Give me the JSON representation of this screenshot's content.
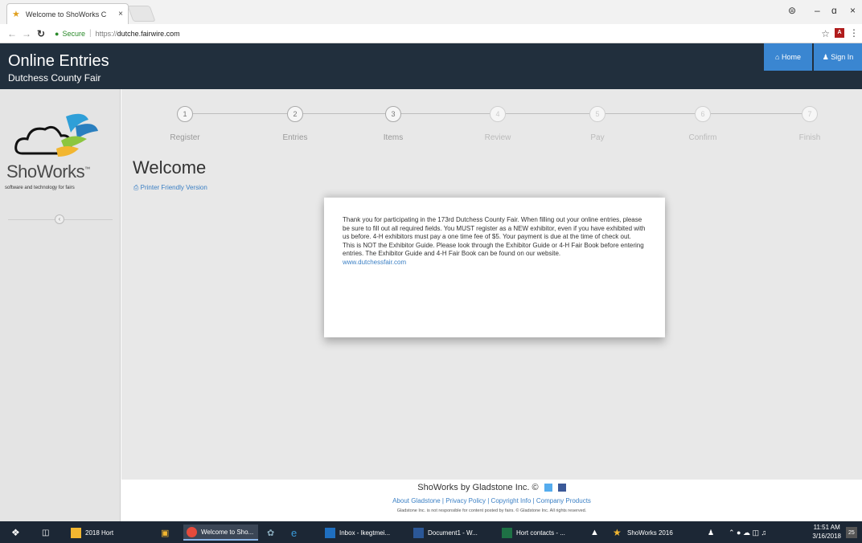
{
  "browser": {
    "tab_title": "Welcome to ShoWorks C",
    "tab_close": "×",
    "secure_label": "Secure",
    "url_scheme": "https://",
    "url_host": "dutche.fairwire.com",
    "window_controls": {
      "profile": "⊜",
      "minimize": "–",
      "maximize": "ɑ",
      "close": "×"
    }
  },
  "header": {
    "title": "Online Entries",
    "subtitle": "Dutchess County Fair",
    "home_label": "⌂ Home",
    "signin_label": "♟ Sign In"
  },
  "sidebar": {
    "logo_text": "ShoWorks",
    "logo_tm": "™",
    "tagline": "software and technology for fairs",
    "collapse_glyph": "‹"
  },
  "steps": [
    {
      "num": "1",
      "label": "Register",
      "active": true
    },
    {
      "num": "2",
      "label": "Entries",
      "active": true
    },
    {
      "num": "3",
      "label": "Items",
      "active": true
    },
    {
      "num": "4",
      "label": "Review",
      "active": false
    },
    {
      "num": "5",
      "label": "Pay",
      "active": false
    },
    {
      "num": "6",
      "label": "Confirm",
      "active": false
    },
    {
      "num": "7",
      "label": "Finish",
      "active": false
    }
  ],
  "main": {
    "title": "Welcome",
    "print_link": "⎙ Printer Friendly Version",
    "welcome_para1": "Thank you for participating in the  173rd Dutchess County Fair. When filling out your online entries, please be sure to fill out all required fields. You MUST register as a NEW exhibitor, even if you have exhibited with us before. 4-H exhibitors must pay a one time fee of $5.  Your payment is due at the time of check out.",
    "welcome_para2": " This is NOT the Exhibitor Guide. Please look through the Exhibitor Guide or 4-H Fair Book before entering entries. The Exhibitor Guide and 4-H Fair Book can be found  on our website.",
    "website_link": "www.dutchessfair.com"
  },
  "footer": {
    "brand": "ShoWorks by Gladstone Inc. ©",
    "links": [
      "About Gladstone",
      "Privacy Policy",
      "Copyright Info",
      "Company Products"
    ],
    "link_sep": " | ",
    "disclaimer": "Gladstone Inc. is not responsible for content posted by fairs. © Gladstone Inc. All rights reserved."
  },
  "taskbar": {
    "items": [
      {
        "label": "2018 Hort",
        "color": "#f2b630"
      },
      {
        "label": "Welcome to Sho...",
        "color": "#e54b3c"
      },
      {
        "label": "Inbox - lkegtmei...",
        "color": "#1f6fc0"
      },
      {
        "label": "Document1 - W...",
        "color": "#2b5797"
      },
      {
        "label": "Hort contacts - ...",
        "color": "#1e7145"
      },
      {
        "label": "ShoWorks 2016",
        "color": "#f2b630"
      }
    ],
    "clock_time": "11:51 AM",
    "clock_date": "3/16/2018",
    "notification_count": "25"
  },
  "colors": {
    "header_bg": "#212f3d",
    "accent_blue": "#3a86d1",
    "link_blue": "#3a7fc4",
    "taskbar_bg": "#1c2735"
  }
}
